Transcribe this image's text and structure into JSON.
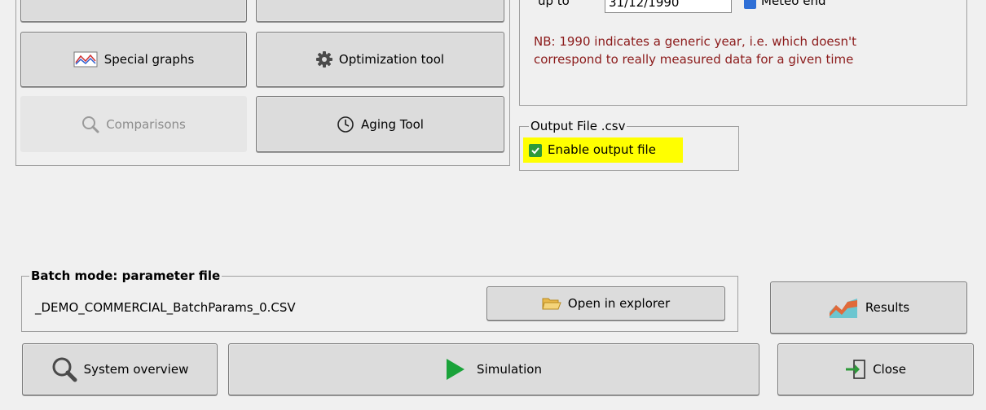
{
  "tools": {
    "special_graphs_label": "Special graphs",
    "optimization_tool_label": "Optimization tool",
    "comparisons_label": "Comparisons",
    "aging_tool_label": "Aging Tool"
  },
  "dates": {
    "up_to_label": "up to",
    "up_to_value": "31/12/1990",
    "meteo_end_label": "Meteo end",
    "note": "NB: 1990 indicates a generic year, i.e. which doesn't correspond to really measured data for a given time"
  },
  "output_file": {
    "group_title": "Output File .csv",
    "enable_label": "Enable output file",
    "enabled": true,
    "highlight_color": "#ffff00"
  },
  "batch": {
    "group_title": "Batch mode: parameter file",
    "file_name": "_DEMO_COMMERCIAL_BatchParams_0.CSV",
    "open_explorer_label": "Open in explorer"
  },
  "bottom": {
    "results_label": "Results",
    "system_overview_label": "System overview",
    "simulation_label": "Simulation",
    "close_label": "Close"
  },
  "colors": {
    "window_bg": "#f0f0f0",
    "button_bg": "#dcdcdc",
    "note_text": "#8b1a1a",
    "checkbox_green": "#2e9a3a",
    "play_green": "#1aa33a"
  }
}
